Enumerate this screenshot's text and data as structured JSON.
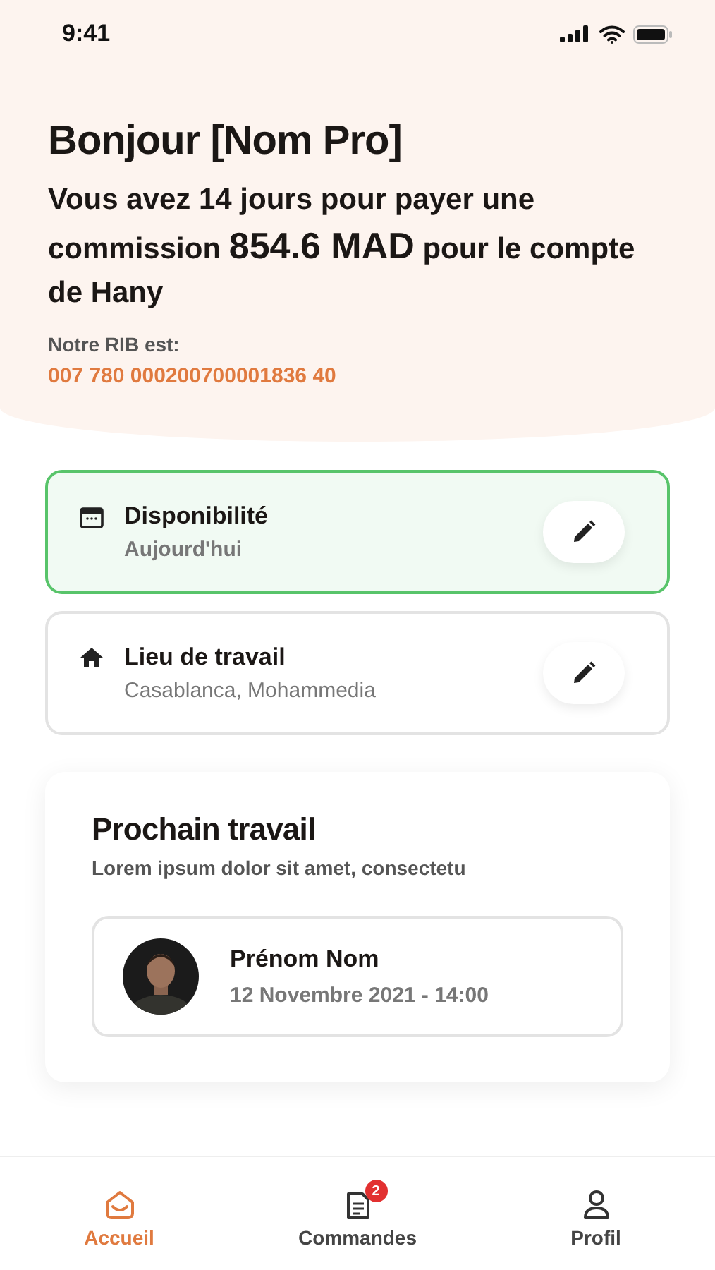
{
  "status_bar": {
    "time": "9:41"
  },
  "header": {
    "greeting": "Bonjour [Nom Pro]",
    "message": "Vous avez 14 jours pour payer une commission **854.6 MAD** pour le compte de Hany",
    "rib_label": "Notre RIB est:",
    "rib": "007 780 000200700001836 40"
  },
  "cards": [
    {
      "kind": "calendar",
      "title": "Disponibilité",
      "subtitle": "Aujourd'hui",
      "selected": true
    },
    {
      "kind": "home",
      "title": "Lieu de travail",
      "subtitle": "Casablanca, Mohammedia",
      "selected": false
    }
  ],
  "next_job": {
    "title": "Prochain travail",
    "subtitle": "Lorem ipsum dolor sit amet, consectetu",
    "person": {
      "name": "Prénom Nom",
      "date": "12 Novembre  2021 - 14:00"
    }
  },
  "nav": [
    {
      "kind": "home",
      "label": "Accueil",
      "selected": true
    },
    {
      "kind": "orders",
      "label": "Commandes",
      "selected": false,
      "badge": "2"
    },
    {
      "kind": "profile",
      "label": "Profil",
      "selected": false
    }
  ]
}
